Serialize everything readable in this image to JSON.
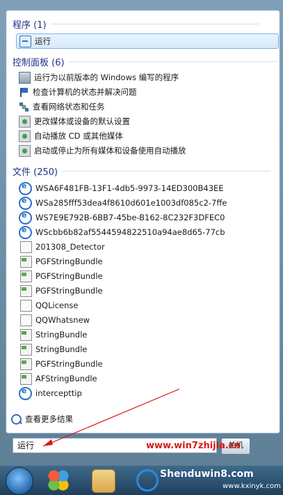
{
  "sections": {
    "programs": {
      "header": "程序 (1)",
      "items": [
        "运行"
      ]
    },
    "control_panel": {
      "header": "控制面板 (6)",
      "items": [
        "运行为以前版本的 Windows 编写的程序",
        "检查计算机的状态并解决问题",
        "查看网络状态和任务",
        "更改媒体或设备的默认设置",
        "自动播放 CD 或其他媒体",
        "启动或停止为所有媒体和设备使用自动播放"
      ]
    },
    "files": {
      "header": "文件 (250)",
      "items": [
        "WSA6F481FB-13F1-4db5-9973-14ED300B43EE",
        "WSa285fff53dea4f8610d601e1003df085c2-7ffe",
        "WS7E9E792B-6BB7-45be-B162-8C232F3DFEC0",
        "WScbb6b82af5544594822510a94ae8d65-77cb",
        "201308_Detector",
        "PGFStringBundle",
        "PGFStringBundle",
        "PGFStringBundle",
        "QQLicense",
        "QQWhatsnew",
        "StringBundle",
        "StringBundle",
        "PGFStringBundle",
        "AFStringBundle",
        "intercepttip"
      ]
    }
  },
  "see_more": "查看更多结果",
  "search": {
    "value": "运行"
  },
  "close_button": "关机",
  "watermarks": {
    "site1": "www.win7zhijia.cn",
    "site2": "Shenduwin8.com",
    "site3": "www.kxinyk.com"
  },
  "colors": {
    "header": "#1e3287",
    "selection_border": "#7db4e8",
    "arrow": "#d81b1b"
  }
}
